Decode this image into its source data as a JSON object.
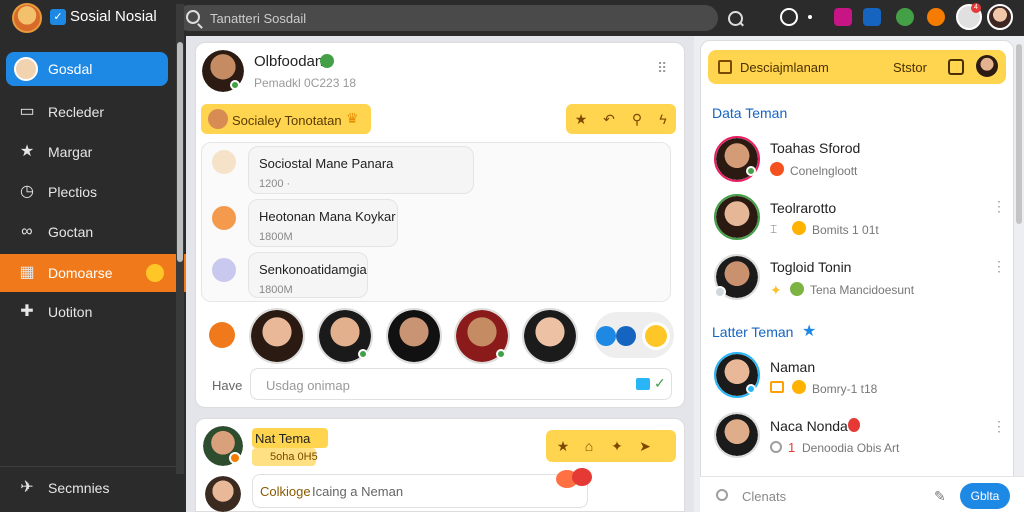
{
  "app": {
    "title": "Sosial Nosial",
    "search_placeholder": "Tanatteri Sosdail"
  },
  "sidebar": {
    "items": [
      {
        "label": "Gosdal",
        "icon": "avatar"
      },
      {
        "label": "Recleder",
        "icon": "inbox-icon"
      },
      {
        "label": "Margar",
        "icon": "star-icon"
      },
      {
        "label": "Plectios",
        "icon": "clock-icon"
      },
      {
        "label": "Goctan",
        "icon": "link-icon"
      },
      {
        "label": "Domoarse",
        "icon": "group-icon"
      },
      {
        "label": "Uotiton",
        "icon": "puzzle-icon"
      }
    ],
    "bottom_label": "Secmnies"
  },
  "post": {
    "author": "Olbfoodan",
    "time": "Pemadkl 0C223 18",
    "tag": "Socialey Tonotatan",
    "messages": [
      {
        "title": "Sociostal Mane Panara",
        "time": "1200 ·"
      },
      {
        "title": "Heotonan Mana Koykar",
        "time": "1800M"
      },
      {
        "title": "Senkonoatidamgia",
        "time": "1800M"
      }
    ],
    "reply_label": "Have",
    "input_placeholder": "Usdag onimap"
  },
  "post2": {
    "author": "Nat Tema",
    "time": "5oha 0H5",
    "highlight": "Colkioge",
    "input_text": "Icaing a Neman"
  },
  "right": {
    "header_label": "Desciajmlanam",
    "header_right": "Ststor",
    "section1": "Data Teman",
    "friends": [
      {
        "name": "Toahas Sforod",
        "sub": "Conelngloott"
      },
      {
        "name": "Teolrarotto",
        "sub": "Bomits 1 01t"
      },
      {
        "name": "Togloid Tonin",
        "sub": "Tena Mancidoesunt"
      }
    ],
    "section2": "Latter Teman",
    "friends2": [
      {
        "name": "Naman",
        "sub": "Bomry-1 t18"
      },
      {
        "name": "Naca Nonda",
        "sub": "Denoodia Obis Art"
      }
    ],
    "footer_placeholder": "Clenats",
    "send_label": "Gblta"
  },
  "colors": {
    "accent_blue": "#1e88e5",
    "accent_orange": "#f07a1b",
    "accent_yellow": "#ffd54f"
  }
}
